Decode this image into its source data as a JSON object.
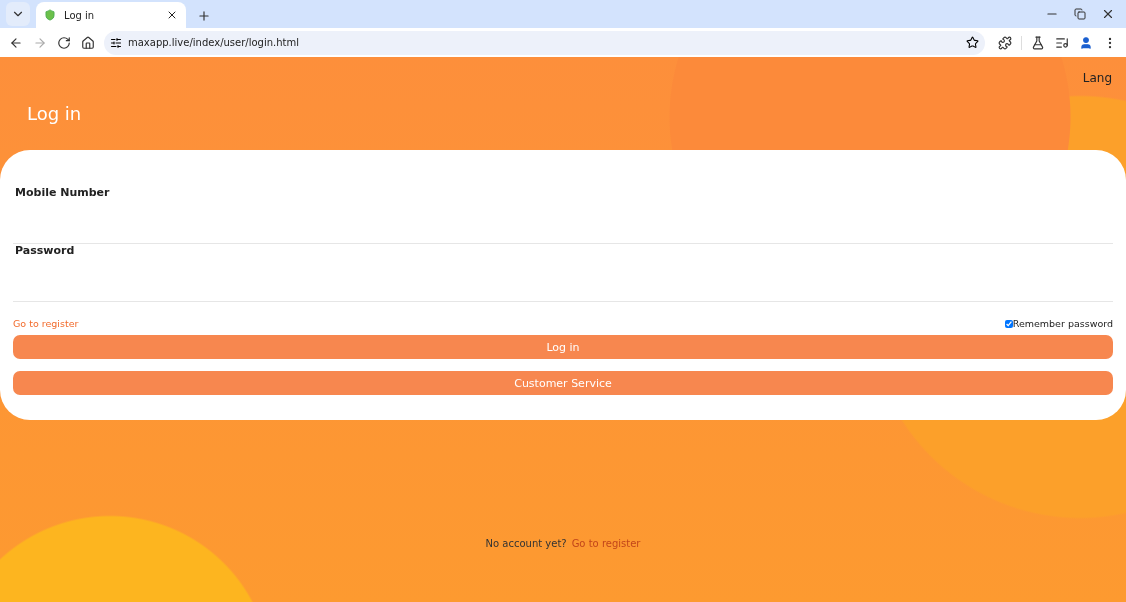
{
  "browser": {
    "tabs": [
      {
        "title": "Log in",
        "selected": true
      }
    ],
    "url": "maxapp.live/index/user/login.html"
  },
  "header": {
    "lang": "Lang",
    "title": "Log in"
  },
  "form": {
    "fields": [
      {
        "label": "Mobile Number"
      },
      {
        "label": "Password"
      }
    ],
    "register_link": "Go to register",
    "remember": {
      "label": "Remember password",
      "checked": true
    },
    "buttons": [
      "Log in",
      "Customer Service"
    ]
  },
  "footer": {
    "text": "No account yet?",
    "link": "Go to register"
  }
}
